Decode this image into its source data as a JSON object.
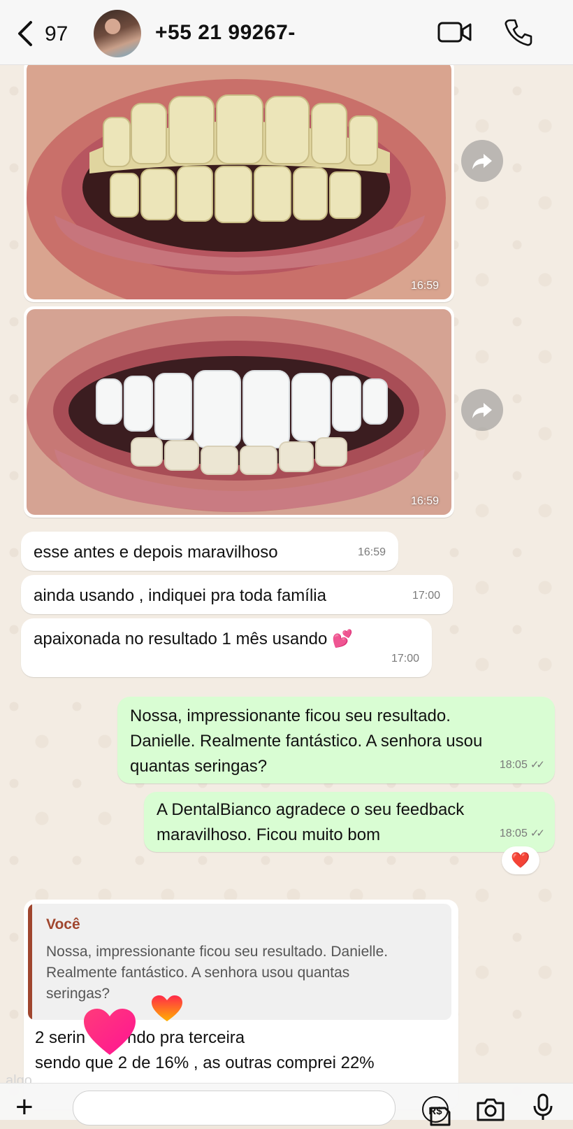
{
  "header": {
    "back_count": "97",
    "contact": "+55 21 99267-"
  },
  "messages": {
    "photo1_time": "16:59",
    "photo2_time": "16:59",
    "m1": {
      "text": "esse antes e depois maravilhoso",
      "time": "16:59"
    },
    "m2": {
      "text": "ainda usando , indiquei pra toda família",
      "time": "17:00"
    },
    "m3": {
      "text": "apaixonada no resultado 1 mês usando 💕",
      "time": "17:00"
    },
    "o1": {
      "line1": "Nossa, impressionante ficou seu resultado.",
      "line2": "Danielle. Realmente fantástico. A senhora usou",
      "line3": "quantas seringas?",
      "time": "18:05"
    },
    "o2": {
      "line1": "A DentalBianco agradece o seu feedback",
      "line2": "maravilhoso. Ficou muito bom",
      "time": "18:05"
    },
    "reaction": "❤️",
    "reply": {
      "quote_author": "Você",
      "quote_line1": "Nossa, impressionante ficou seu resultado. Danielle.",
      "quote_line2": "Realmente fantástico. A senhora usou quantas",
      "quote_line3": "seringas?",
      "line1": "2 serin         ndo pra terceira",
      "line2": "sendo que 2 de 16% , as outras comprei 22%"
    }
  },
  "watermark": "algo...",
  "input": {
    "pay_label": "R$"
  },
  "colors": {
    "outgoing_bubble": "#d9fdd3",
    "incoming_bubble": "#ffffff",
    "quote_accent": "#a0462e",
    "heart": "#e0233a"
  },
  "icons": [
    "back-chevron-icon",
    "video-call-icon",
    "phone-icon",
    "forward-icon",
    "plus-icon",
    "sticker-icon",
    "payment-icon",
    "camera-icon",
    "microphone-icon",
    "heart-icon"
  ]
}
